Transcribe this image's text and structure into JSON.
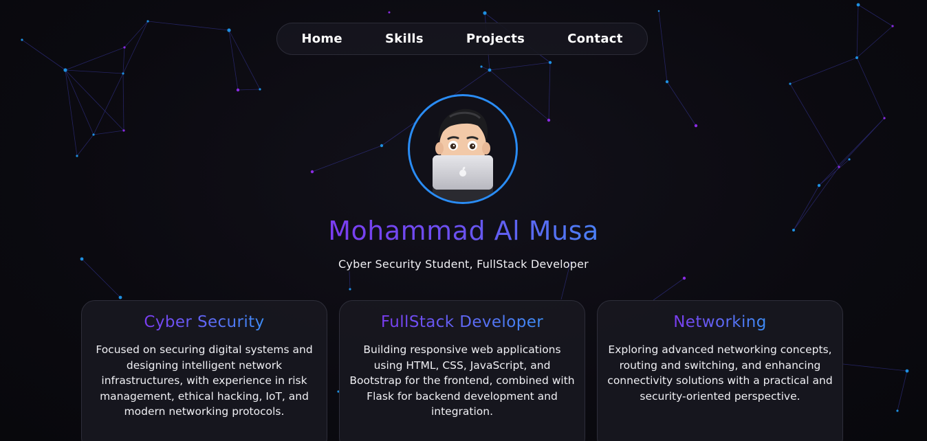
{
  "nav": {
    "items": [
      {
        "label": "Home"
      },
      {
        "label": "Skills"
      },
      {
        "label": "Projects"
      },
      {
        "label": "Contact"
      }
    ]
  },
  "profile": {
    "name": "Mohammad Al Musa",
    "subtitle": "Cyber Security Student, FullStack Developer",
    "avatar_icon": "memoji-laptop-avatar",
    "accent_ring_color": "#2a8cf4"
  },
  "colors": {
    "background": "#0b0a10",
    "gradient_start": "#7b3cf0",
    "gradient_end": "#4a80f5",
    "node_blue": "#1e8fe0",
    "node_purple": "#8a2be2"
  },
  "cards": [
    {
      "title": "Cyber Security",
      "text": "Focused on securing digital systems and designing intelligent network infrastructures, with experience in risk management, ethical hacking, IoT, and modern networking protocols."
    },
    {
      "title": "FullStack Developer",
      "text": "Building responsive web applications using HTML, CSS, JavaScript, and Bootstrap for the frontend, combined with Flask for backend development and integration."
    },
    {
      "title": "Networking",
      "text": "Exploring advanced networking concepts, routing and switching, and enhancing connectivity solutions with a practical and security-oriented perspective."
    }
  ]
}
